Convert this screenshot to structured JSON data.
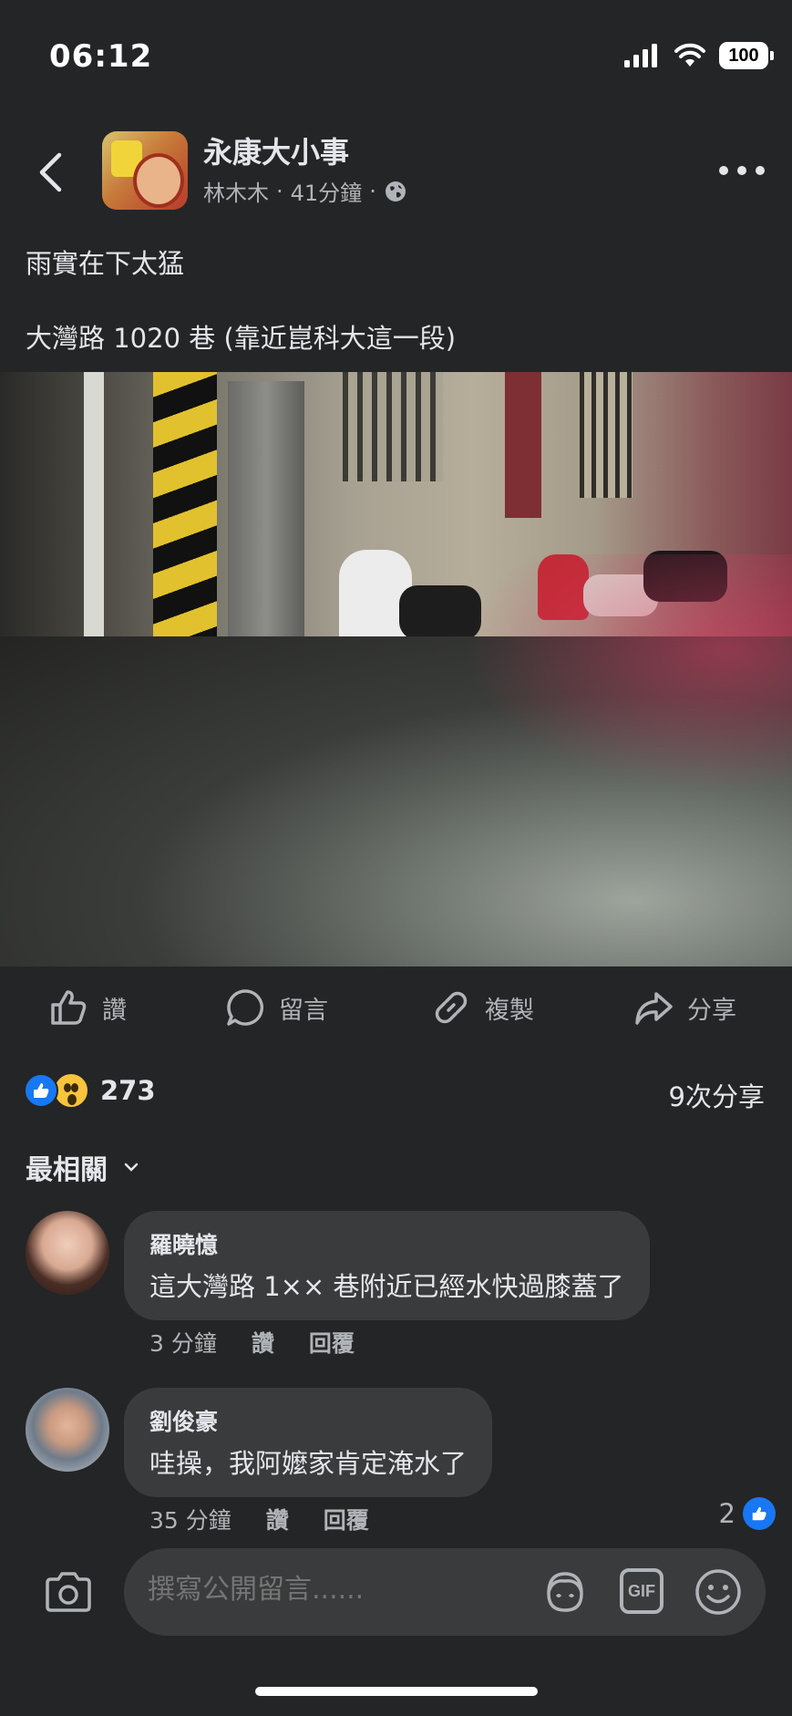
{
  "status_bar": {
    "time": "06:12",
    "battery": "100"
  },
  "header": {
    "group_name": "永康大小事",
    "author": "林木木",
    "separator": "·",
    "time_ago": "41分鐘",
    "audience_icon": "globe-icon"
  },
  "post": {
    "line1": "雨實在下太猛",
    "line2": "大灣路 1020 巷 (靠近崑科大這一段)"
  },
  "actions": [
    {
      "label": "讚",
      "icon": "like-icon"
    },
    {
      "label": "留言",
      "icon": "comment-icon"
    },
    {
      "label": "複製",
      "icon": "link-icon"
    },
    {
      "label": "分享",
      "icon": "share-icon"
    }
  ],
  "reactions": {
    "count": "273",
    "shares": "9次分享"
  },
  "sort": {
    "label": "最相關"
  },
  "comments": [
    {
      "author": "羅曉憶",
      "text": "這大灣路 1×× 巷附近已經水快過膝蓋了",
      "time": "3 分鐘",
      "like": "讚",
      "reply": "回覆",
      "likes": ""
    },
    {
      "author": "劉俊豪",
      "text": "哇操，我阿嬤家肯定淹水了",
      "time": "35 分鐘",
      "like": "讚",
      "reply": "回覆",
      "likes": "2"
    }
  ],
  "composer": {
    "placeholder": "撰寫公開留言......",
    "gif_label": "GIF"
  },
  "colors": {
    "background": "#242526",
    "bubble": "#3a3b3c",
    "accent": "#1877f2",
    "text_secondary": "#b0b3b8"
  }
}
